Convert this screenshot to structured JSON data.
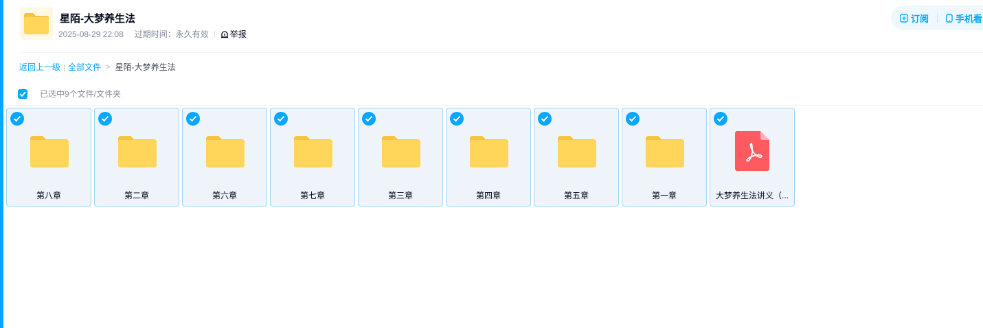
{
  "header": {
    "title": "星陌-大梦养生法",
    "time": "2025-08-29 22:08",
    "expiry": "过期时间：永久有效",
    "report_label": "举报"
  },
  "actions": {
    "subscribe_label": "订阅",
    "mobile_label": "手机看"
  },
  "breadcrumb": {
    "back_label": "返回上一级",
    "all_files_label": "全部文件",
    "current_label": "星陌-大梦养生法"
  },
  "selection": {
    "status_text": "已选中9个文件/文件夹"
  },
  "files": [
    {
      "name": "第八章",
      "type": "folder",
      "selected": true
    },
    {
      "name": "第二章",
      "type": "folder",
      "selected": true
    },
    {
      "name": "第六章",
      "type": "folder",
      "selected": true
    },
    {
      "name": "第七章",
      "type": "folder",
      "selected": true
    },
    {
      "name": "第三章",
      "type": "folder",
      "selected": true
    },
    {
      "name": "第四章",
      "type": "folder",
      "selected": true
    },
    {
      "name": "第五章",
      "type": "folder",
      "selected": true
    },
    {
      "name": "第一章",
      "type": "folder",
      "selected": true
    },
    {
      "name": "大梦养生法讲义（...",
      "type": "pdf",
      "selected": true
    }
  ],
  "colors": {
    "accent": "#06a7ff",
    "folder": "#ffd659",
    "pdf": "#ff5a5f"
  }
}
